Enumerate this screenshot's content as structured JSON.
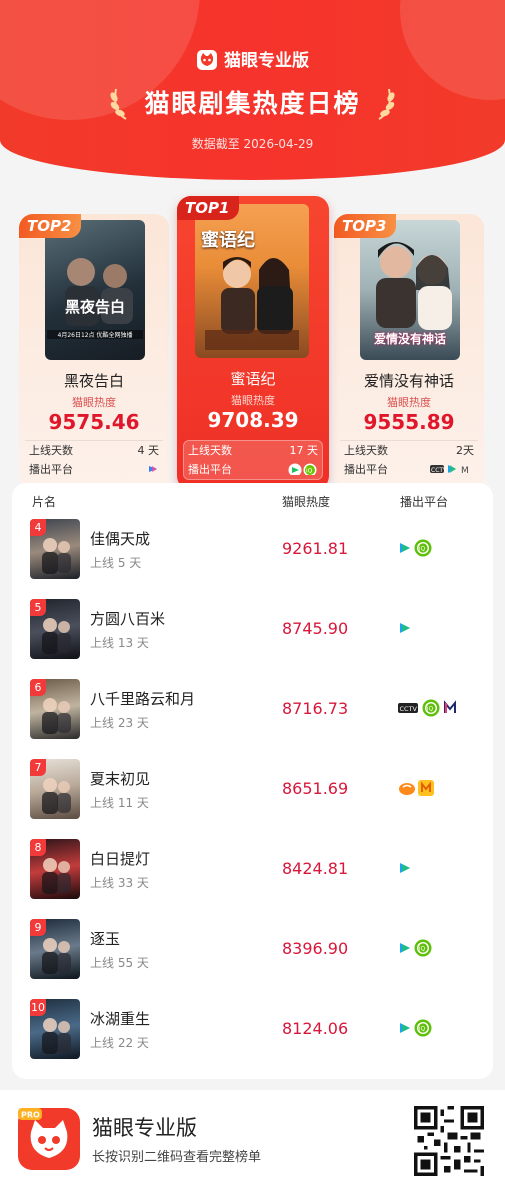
{
  "header": {
    "brand": "猫眼专业版",
    "title": "猫眼剧集热度日榜",
    "date_note": "数据截至 2026-04-29"
  },
  "top3": [
    {
      "tag": "TOP1",
      "name": "蜜语纪",
      "score_label": "猫眼热度",
      "score": "9708.39",
      "days_label": "上线天数",
      "days": "17 天",
      "platform_label": "播出平台",
      "poster_text": "蜜语纪",
      "platforms": [
        "tencent-video",
        "iqiyi"
      ]
    },
    {
      "tag": "TOP2",
      "name": "黑夜告白",
      "score_label": "猫眼热度",
      "score": "9575.46",
      "days_label": "上线天数",
      "days": "4 天",
      "platform_label": "播出平台",
      "poster_text": "黑夜告白",
      "poster_sub": "4月26日12点 优酷全网独播",
      "platforms": [
        "youku"
      ]
    },
    {
      "tag": "TOP3",
      "name": "爱情没有神话",
      "score_label": "猫眼热度",
      "score": "9555.89",
      "days_label": "上线天数",
      "days": "2天",
      "platform_label": "播出平台",
      "poster_text": "爱情没有神话",
      "platforms": [
        "cctv",
        "tencent-video",
        "mgtv"
      ]
    }
  ],
  "table": {
    "col_name": "片名",
    "col_score": "猫眼热度",
    "col_platform": "播出平台",
    "rows": [
      {
        "rank": "4",
        "name": "佳偶天成",
        "days": "上线 5 天",
        "score": "9261.81",
        "platforms": [
          "tencent-video",
          "iqiyi"
        ]
      },
      {
        "rank": "5",
        "name": "方圆八百米",
        "days": "上线 13 天",
        "score": "8745.90",
        "platforms": [
          "tencent-video"
        ]
      },
      {
        "rank": "6",
        "name": "八千里路云和月",
        "days": "上线 23 天",
        "score": "8716.73",
        "platforms": [
          "cctv",
          "iqiyi",
          "mgtv"
        ]
      },
      {
        "rank": "7",
        "name": "夏末初见",
        "days": "上线 11 天",
        "score": "8651.69",
        "platforms": [
          "mango",
          "mango-tv"
        ]
      },
      {
        "rank": "8",
        "name": "白日提灯",
        "days": "上线 33 天",
        "score": "8424.81",
        "platforms": [
          "tencent-video"
        ]
      },
      {
        "rank": "9",
        "name": "逐玉",
        "days": "上线 55 天",
        "score": "8396.90",
        "platforms": [
          "tencent-video",
          "iqiyi"
        ]
      },
      {
        "rank": "10",
        "name": "冰湖重生",
        "days": "上线 22 天",
        "score": "8124.06",
        "platforms": [
          "tencent-video",
          "iqiyi"
        ]
      }
    ]
  },
  "footer": {
    "title": "猫眼专业版",
    "subtitle": "长按识别二维码查看完整榜单",
    "badge": "PRO"
  },
  "colors": {
    "accent": "#f23a2a",
    "score": "#d8173a"
  }
}
